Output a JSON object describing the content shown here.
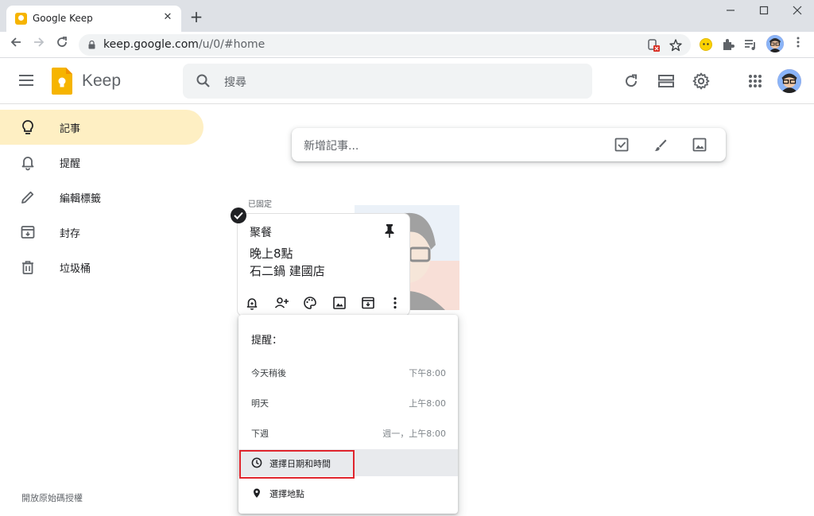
{
  "browser": {
    "tab_title": "Google Keep",
    "tab_close": "✕",
    "new_tab": "+",
    "url_host": "keep.google.com",
    "url_path": "/u/0/#home"
  },
  "app": {
    "name": "Keep",
    "search_placeholder": "搜尋"
  },
  "sidebar": {
    "items": [
      {
        "label": "記事",
        "icon": "lightbulb-icon",
        "active": true
      },
      {
        "label": "提醒",
        "icon": "bell-icon"
      },
      {
        "label": "編輯標籤",
        "icon": "pencil-icon"
      },
      {
        "label": "封存",
        "icon": "archive-icon"
      },
      {
        "label": "垃圾桶",
        "icon": "trash-icon"
      }
    ],
    "footer": "開放原始碼授權"
  },
  "take_note": {
    "placeholder": "新增記事..."
  },
  "pinned": {
    "label": "已固定",
    "note": {
      "title": "聚餐",
      "lines": [
        "晚上8點",
        "石二鍋 建國店"
      ]
    }
  },
  "reminder_menu": {
    "title": "提醒：",
    "options": [
      {
        "label": "今天稍後",
        "time": "下午8:00"
      },
      {
        "label": "明天",
        "time": "上午8:00"
      },
      {
        "label": "下週",
        "time": "週一，上午8:00"
      }
    ],
    "pick_datetime": "選擇日期和時間",
    "pick_place": "選擇地點"
  },
  "colors": {
    "accent_yellow": "#feefc3",
    "logo_yellow": "#f6b400",
    "highlight_red": "#e0252d"
  }
}
